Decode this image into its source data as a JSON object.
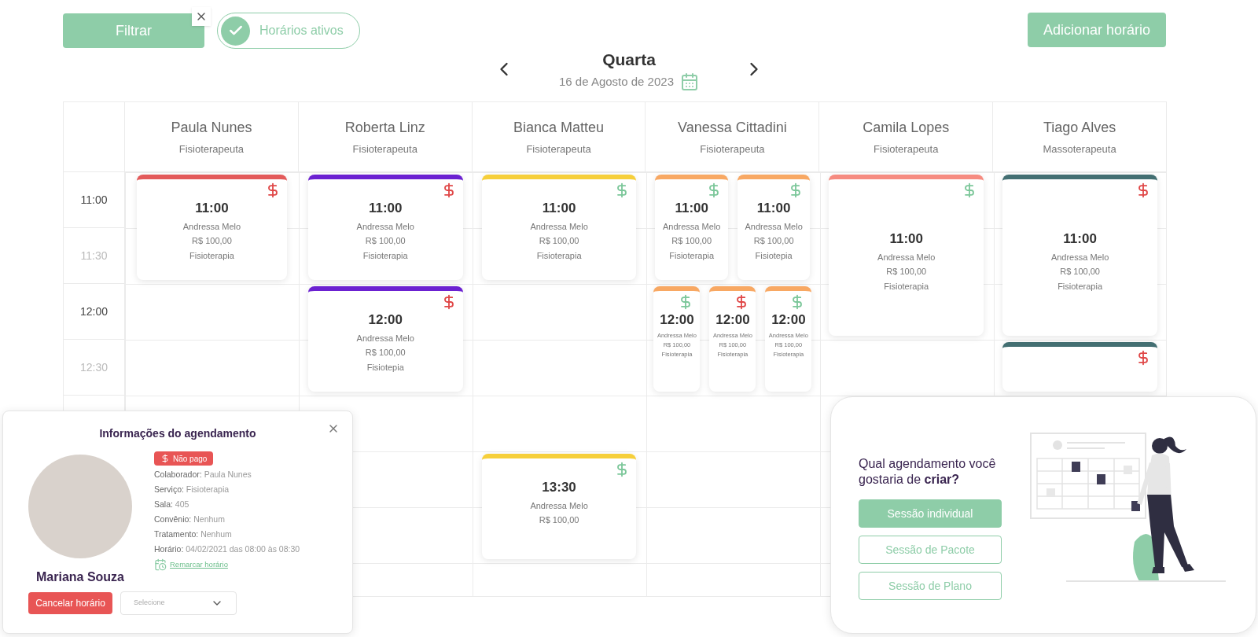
{
  "toolbar": {
    "filter_button": "Filtrar",
    "active_toggle": {
      "label": "Horários ativos",
      "on": true
    },
    "add_button": "Adicionar horário"
  },
  "date_header": {
    "weekday": "Quarta",
    "date": "16 de Agosto de 2023"
  },
  "time_rows": [
    {
      "time": "11:00",
      "half": false
    },
    {
      "time": "11:30",
      "half": true
    },
    {
      "time": "12:00",
      "half": false
    },
    {
      "time": "12:30",
      "half": true
    }
  ],
  "columns": [
    {
      "name": "Paula Nunes",
      "role": "Fisioterapeuta",
      "appointments": [
        {
          "cards": [
            {
              "color": "#e35a5a",
              "paid": false,
              "time": "11:00",
              "patient": "Andressa Melo",
              "price": "R$ 100,00",
              "service": "Fisioterapia"
            }
          ]
        }
      ]
    },
    {
      "name": "Roberta Linz",
      "role": "Fisioterapeuta",
      "appointments": [
        {
          "cards": [
            {
              "color": "#6b21d1",
              "paid": false,
              "time": "11:00",
              "patient": "Andressa Melo",
              "price": "R$ 100,00",
              "service": "Fisioterapia"
            }
          ]
        },
        {
          "cards": [
            {
              "color": "#6b21d1",
              "paid": false,
              "time": "12:00",
              "patient": "Andressa Melo",
              "price": "R$ 100,00",
              "service": "Fisiotepia"
            }
          ]
        }
      ]
    },
    {
      "name": "Bianca Matteu",
      "role": "Fisioterapeuta",
      "appointments": [
        {
          "cards": [
            {
              "color": "#f6cf3a",
              "paid": true,
              "time": "11:00",
              "patient": "Andressa Melo",
              "price": "R$ 100,00",
              "service": "Fisioterapia"
            }
          ]
        },
        {
          "cards": [
            {
              "color": "#f6cf3a",
              "paid": true,
              "time": "13:30",
              "patient": "Andressa Melo",
              "price": "R$ 100,00"
            }
          ]
        }
      ]
    },
    {
      "name": "Vanessa Cittadini",
      "role": "Fisioterapeuta",
      "appointments": [
        {
          "cards": [
            {
              "color": "#f8a863",
              "paid": true,
              "time": "11:00",
              "patient": "Andressa Melo",
              "price": "R$ 100,00",
              "service": "Fisioterapia"
            },
            {
              "color": "#f8a863",
              "paid": true,
              "time": "11:00",
              "patient": "Andressa Melo",
              "price": "R$ 100,00",
              "service": "Fisiotepia"
            }
          ]
        },
        {
          "cards": [
            {
              "color": "#f8a863",
              "paid": true,
              "time": "12:00",
              "patient": "Andressa Melo",
              "price": "R$ 100,00",
              "service": "Fisioterapia"
            },
            {
              "color": "#f8a863",
              "paid": false,
              "time": "12:00",
              "patient": "Andressa Melo",
              "price": "R$ 100,00",
              "service": "Fisioterapia"
            },
            {
              "color": "#f8a863",
              "paid": true,
              "time": "12:00",
              "patient": "Andressa Melo",
              "price": "R$ 100,00",
              "service": "Fisioterapia"
            }
          ]
        }
      ]
    },
    {
      "name": "Camila Lopes",
      "role": "Fisioterapeuta",
      "appointments": [
        {
          "cards": [
            {
              "color": "#f68b80",
              "paid": true,
              "time": "11:00",
              "patient": "Andressa Melo",
              "price": "R$ 100,00",
              "service": "Fisioterapia"
            }
          ]
        }
      ]
    },
    {
      "name": "Tiago Alves",
      "role": "Massoterapeuta",
      "appointments": [
        {
          "cards": [
            {
              "color": "#436f72",
              "paid": false,
              "time": "11:00",
              "patient": "Andressa Melo",
              "price": "R$ 100,00",
              "service": "Fisioterapia"
            }
          ]
        },
        {
          "cards": [
            {
              "color": "#436f72",
              "paid": false
            }
          ]
        }
      ]
    }
  ],
  "info_panel": {
    "title": "Informações do agendamento",
    "client_name": "Mariana Souza",
    "status": {
      "label": "Não pago",
      "paid": false
    },
    "details": [
      {
        "label": "Colaborador:",
        "value": "Paula Nunes"
      },
      {
        "label": "Serviço:",
        "value": "Fisioterapia"
      },
      {
        "label": "Sala:",
        "value": "405"
      },
      {
        "label": "Convênio:",
        "value": "Nenhum"
      },
      {
        "label": "Tratamento:",
        "value": "Nenhum"
      },
      {
        "label": "Horário:",
        "value": "04/02/2021 das 08:00 às 08:30"
      }
    ],
    "reschedule_link": "Remarcar horário",
    "cancel_button": "Cancelar horário",
    "select": {
      "placeholder": "Selecione"
    }
  },
  "create_panel": {
    "question": "Qual agendamento você gostaria de **criar?**",
    "options": [
      {
        "label": "Sessão individual",
        "selected": true
      },
      {
        "label": "Sessão de Pacote",
        "selected": false
      },
      {
        "label": "Sessão de Plano",
        "selected": false
      }
    ]
  }
}
